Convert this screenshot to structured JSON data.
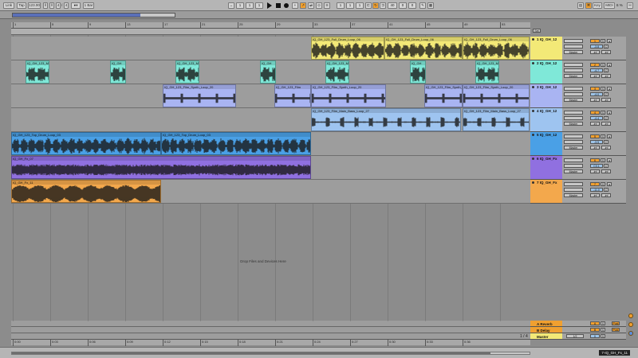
{
  "transport": {
    "link": "Link",
    "tap": "Tap",
    "tempo": "123.00",
    "sig_num": "4",
    "sig_den": "4",
    "metronome": "1 Bar",
    "pos1": "1",
    "pos2": "1",
    "pos3": "1",
    "loop1": "1",
    "loop2": "1",
    "loop3": "1",
    "loop_len": "40",
    "loop_len2": "0",
    "loop_len3": "0",
    "key": "Key",
    "midi": "MIDI",
    "cpu": "6 %"
  },
  "ruler": {
    "bars": [
      "1",
      "5",
      "9",
      "13",
      "17",
      "21",
      "25",
      "29",
      "33",
      "37",
      "41",
      "45",
      "49",
      "53"
    ],
    "times": [
      "0:00",
      "0:03",
      "0:06",
      "0:09",
      "0:12",
      "0:15",
      "0:18",
      "0:21",
      "0:24",
      "0:27",
      "0:30",
      "0:33",
      "0:36"
    ]
  },
  "drop_text": "Drop Files and Devices Here",
  "tracks": [
    {
      "name": "1 IQ_GH_12",
      "color": "#f3e977",
      "clips": [
        {
          "label": "IQ_GH_123_Full_Drum_Loop_06"
        },
        {
          "label": "IQ_GH_123_Full_Drum_Loop_06"
        },
        {
          "label": "IQ_GH_123_Full_Drum_Loop_06"
        }
      ]
    },
    {
      "name": "2 IQ_GH_12",
      "color": "#7fe8d8",
      "clips": [
        {
          "label": "IQ_GH_123_M"
        },
        {
          "label": "IQ_GH"
        },
        {
          "label": "IQ_GH_123_M"
        },
        {
          "label": "IQ_GH"
        },
        {
          "label": "IQ_GH_123_M"
        },
        {
          "label": "IQ_GH"
        },
        {
          "label": "IQ_GH_123_M"
        }
      ]
    },
    {
      "name": "3 IQ_GH_12",
      "color": "#a9b4f2",
      "clips": [
        {
          "label": "IQ_GH_123_Film_Synth_Loop_20"
        },
        {
          "label": "IQ_GH_123_Film"
        },
        {
          "label": "IQ_GH_123_Film_Synth_Loop_20"
        },
        {
          "label": "IQ_GH_123_Film_Synth_Loop_20"
        },
        {
          "label": "IQ_GH_123_Film_Synth_Loop_20"
        }
      ]
    },
    {
      "name": "4 IQ_GH_12",
      "color": "#9ec4f0",
      "clips": [
        {
          "label": "IQ_GH_123_Film_Main_Bass_Loop_27"
        },
        {
          "label": "IQ_GH_123_Film_Main_Bass_Loop_27"
        }
      ]
    },
    {
      "name": "5 IQ_GH_12",
      "color": "#4aa0e6",
      "clips": [
        {
          "label": "IQ_GH_123_Top_Drum_Loop_03"
        },
        {
          "label": "IQ_GH_123_Top_Drum_Loop_03"
        }
      ]
    },
    {
      "name": "6 IQ_GH_Fx",
      "color": "#9070e0",
      "clips": [
        {
          "label": "IQ_GH_Fx_07"
        }
      ]
    },
    {
      "name": "7 IQ_GH_Fx",
      "color": "#f3a84c",
      "clips": [
        {
          "label": "IQ_GH_Fx_11"
        }
      ]
    }
  ],
  "mixer": {
    "routing": "Master",
    "vol_values": [
      "1",
      "2",
      "3",
      "4",
      "5",
      "6",
      "7"
    ],
    "pan_values": [
      "-3.8",
      "-4.7",
      "-4.0",
      "-4.4",
      "-3.5",
      "C0.1",
      "-11.0"
    ],
    "inf": "-inf",
    "s": "S",
    "set": "Set"
  },
  "returns": [
    {
      "name": "A Reverb",
      "color": "#f0a030",
      "val": "A"
    },
    {
      "name": "B Delay",
      "color": "#f0a030",
      "val": "B"
    }
  ],
  "master": {
    "name": "Master",
    "color": "#f3e977",
    "val": "1/2"
  },
  "status": "7-IQ_GH_Fx_11",
  "zoom": "1 / 4"
}
